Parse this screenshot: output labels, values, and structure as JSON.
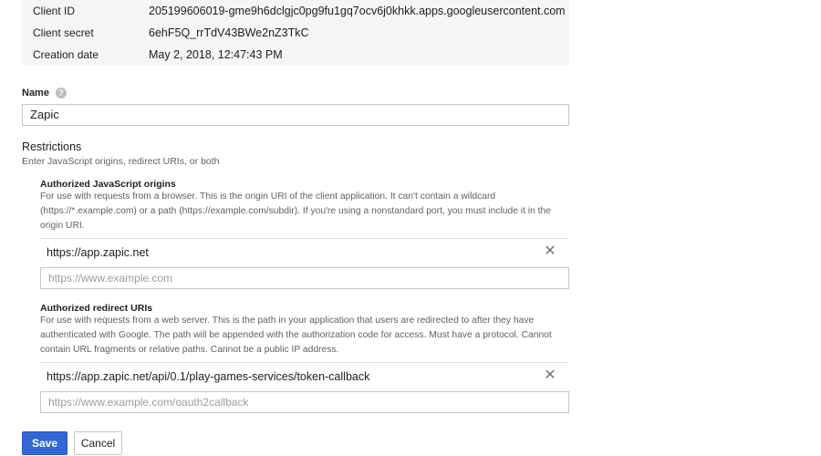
{
  "client_info": {
    "client_id_label": "Client ID",
    "client_id_value": "205199606019-gme9h6dclgjc0pg9fu1gq7ocv6j0khkk.apps.googleusercontent.com",
    "client_secret_label": "Client secret",
    "client_secret_value": "6ehF5Q_rrTdV43BWe2nZ3TkC",
    "creation_date_label": "Creation date",
    "creation_date_value": "May 2, 2018, 12:47:43 PM"
  },
  "name_field": {
    "label": "Name",
    "help_icon": "help-circle-icon",
    "help_glyph": "?",
    "value": "Zapic"
  },
  "restrictions": {
    "title": "Restrictions",
    "subtitle": "Enter JavaScript origins, redirect URIs, or both",
    "js_origins": {
      "title": "Authorized JavaScript origins",
      "description": "For use with requests from a browser. This is the origin URI of the client application. It can't contain a wildcard (https://*.example.com) or a path (https://example.com/subdir). If you're using a nonstandard port, you must include it in the origin URI.",
      "entries": [
        "https://app.zapic.net"
      ],
      "placeholder": "https://www.example.com"
    },
    "redirect_uris": {
      "title": "Authorized redirect URIs",
      "description": "For use with requests from a web server. This is the path in your application that users are redirected to after they have authenticated with Google. The path will be appended with the authorization code for access. Must have a protocol. Cannot contain URL fragments or relative paths. Cannot be a public IP address.",
      "entries": [
        "https://app.zapic.net/api/0.1/play-games-services/token-callback"
      ],
      "placeholder": "https://www.example.com/oauth2callback"
    },
    "remove_icon": "close-icon",
    "remove_glyph": "✕"
  },
  "actions": {
    "save_label": "Save",
    "cancel_label": "Cancel"
  },
  "colors": {
    "primary_button": "#3367d6",
    "info_background": "#f5f5f5"
  }
}
